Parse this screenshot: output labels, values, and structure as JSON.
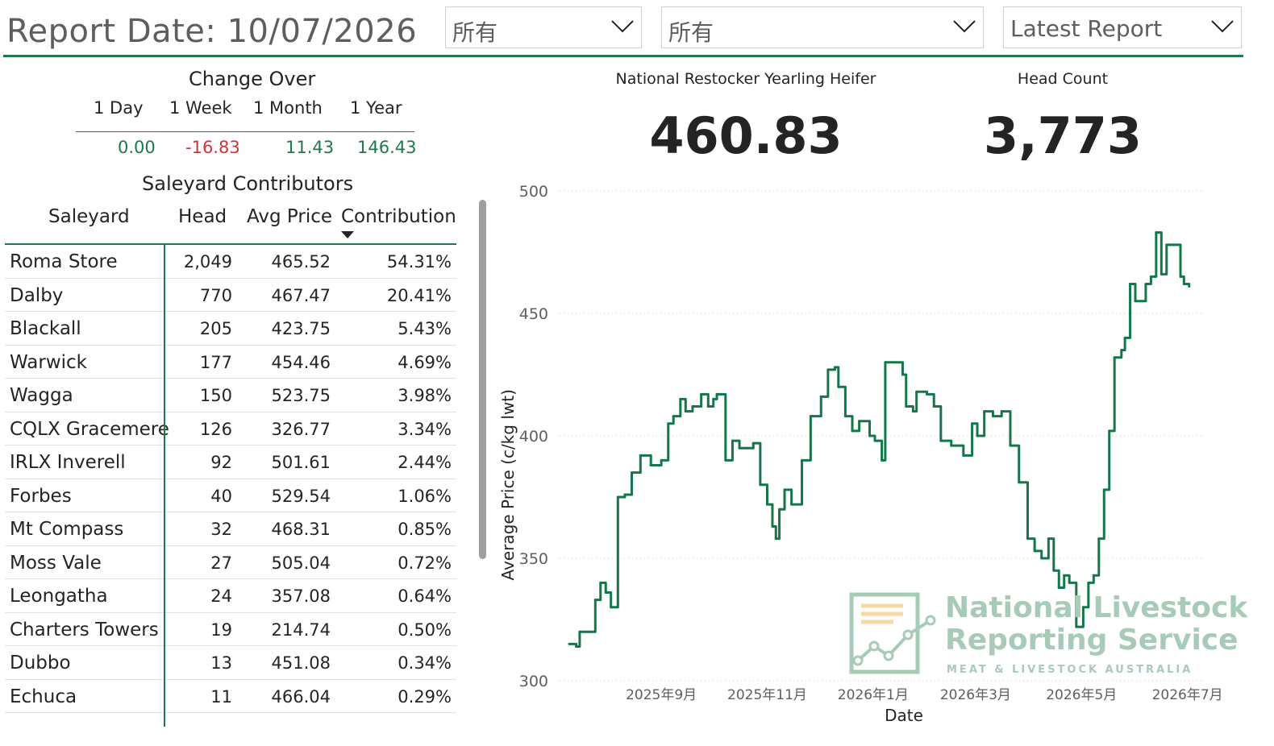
{
  "report_date": "Report Date: 10/07/2026",
  "slicers": [
    {
      "value": "所有"
    },
    {
      "value": "所有"
    },
    {
      "value": "Latest Report"
    }
  ],
  "change_over": {
    "title": "Change Over",
    "periods": [
      "1 Day",
      "1 Week",
      "1 Month",
      "1 Year"
    ],
    "values": [
      "0.00",
      "-16.83",
      "11.43",
      "146.43"
    ]
  },
  "saleyard": {
    "title": "Saleyard Contributors",
    "headers": [
      "Saleyard",
      "Head",
      "Avg Price",
      "Contribution"
    ],
    "rows": [
      {
        "name": "Roma Store",
        "head": "2,049",
        "price": "465.52",
        "contribution": "54.31%"
      },
      {
        "name": "Dalby",
        "head": "770",
        "price": "467.47",
        "contribution": "20.41%"
      },
      {
        "name": "Blackall",
        "head": "205",
        "price": "423.75",
        "contribution": "5.43%"
      },
      {
        "name": "Warwick",
        "head": "177",
        "price": "454.46",
        "contribution": "4.69%"
      },
      {
        "name": "Wagga",
        "head": "150",
        "price": "523.75",
        "contribution": "3.98%"
      },
      {
        "name": "CQLX Gracemere",
        "head": "126",
        "price": "326.77",
        "contribution": "3.34%"
      },
      {
        "name": "IRLX Inverell",
        "head": "92",
        "price": "501.61",
        "contribution": "2.44%"
      },
      {
        "name": "Forbes",
        "head": "40",
        "price": "529.54",
        "contribution": "1.06%"
      },
      {
        "name": "Mt Compass",
        "head": "32",
        "price": "468.31",
        "contribution": "0.85%"
      },
      {
        "name": "Moss Vale",
        "head": "27",
        "price": "505.04",
        "contribution": "0.72%"
      },
      {
        "name": "Leongatha",
        "head": "24",
        "price": "357.08",
        "contribution": "0.64%"
      },
      {
        "name": "Charters Towers",
        "head": "19",
        "price": "214.74",
        "contribution": "0.50%"
      },
      {
        "name": "Dubbo",
        "head": "13",
        "price": "451.08",
        "contribution": "0.34%"
      },
      {
        "name": "Echuca",
        "head": "11",
        "price": "466.04",
        "contribution": "0.29%"
      }
    ]
  },
  "kpis": [
    {
      "label": "National Restocker Yearling Heifer",
      "value": "460.83"
    },
    {
      "label": "Head Count",
      "value": "3,773"
    }
  ],
  "watermark": {
    "line1": "National Livestock",
    "line2": "Reporting Service",
    "sub": "MEAT & LIVESTOCK AUSTRALIA"
  },
  "colors": {
    "accent": "#1d7a4d",
    "negative": "#d13438",
    "line": "#13774a",
    "watermark": "#a7cbb6"
  },
  "chart_data": {
    "type": "line",
    "xlabel": "Date",
    "ylabel": "Average Price (c/kg lwt)",
    "ylim": [
      300,
      500
    ],
    "yticks": [
      300,
      350,
      400,
      450,
      500
    ],
    "xticks": [
      "2025年9月",
      "2025年11月",
      "2026年1月",
      "2026年3月",
      "2026年5月",
      "2026年7月"
    ],
    "x_range": [
      "2025-07-10",
      "2026-07-10"
    ],
    "grid": true,
    "series": [
      {
        "values": [
          [
            "2025-07-10",
            315
          ],
          [
            "2025-07-14",
            314
          ],
          [
            "2025-07-16",
            320
          ],
          [
            "2025-07-21",
            320
          ],
          [
            "2025-07-25",
            333
          ],
          [
            "2025-07-28",
            340
          ],
          [
            "2025-07-31",
            336
          ],
          [
            "2025-08-03",
            330
          ],
          [
            "2025-08-07",
            375
          ],
          [
            "2025-08-11",
            376
          ],
          [
            "2025-08-15",
            385
          ],
          [
            "2025-08-20",
            392
          ],
          [
            "2025-08-26",
            388
          ],
          [
            "2025-09-01",
            390
          ],
          [
            "2025-09-05",
            405
          ],
          [
            "2025-09-08",
            408
          ],
          [
            "2025-09-12",
            415
          ],
          [
            "2025-09-15",
            410
          ],
          [
            "2025-09-19",
            412
          ],
          [
            "2025-09-24",
            417
          ],
          [
            "2025-09-28",
            412
          ],
          [
            "2025-10-01",
            415
          ],
          [
            "2025-10-03",
            417
          ],
          [
            "2025-10-08",
            390
          ],
          [
            "2025-10-12",
            398
          ],
          [
            "2025-10-16",
            395
          ],
          [
            "2025-10-20",
            395
          ],
          [
            "2025-10-24",
            397
          ],
          [
            "2025-10-28",
            380
          ],
          [
            "2025-11-01",
            372
          ],
          [
            "2025-11-04",
            363
          ],
          [
            "2025-11-06",
            358
          ],
          [
            "2025-11-08",
            370
          ],
          [
            "2025-11-11",
            378
          ],
          [
            "2025-11-15",
            372
          ],
          [
            "2025-11-21",
            390
          ],
          [
            "2025-11-26",
            408
          ],
          [
            "2025-12-02",
            416
          ],
          [
            "2025-12-06",
            427
          ],
          [
            "2025-12-10",
            428
          ],
          [
            "2025-12-12",
            420
          ],
          [
            "2025-12-16",
            408
          ],
          [
            "2025-12-20",
            402
          ],
          [
            "2025-12-24",
            406
          ],
          [
            "2025-12-30",
            400
          ],
          [
            "2026-01-02",
            398
          ],
          [
            "2026-01-06",
            390
          ],
          [
            "2026-01-08",
            430
          ],
          [
            "2026-01-18",
            425
          ],
          [
            "2026-01-20",
            412
          ],
          [
            "2026-01-24",
            410
          ],
          [
            "2026-01-26",
            418
          ],
          [
            "2026-02-01",
            417
          ],
          [
            "2026-02-05",
            412
          ],
          [
            "2026-02-09",
            398
          ],
          [
            "2026-02-15",
            396
          ],
          [
            "2026-02-22",
            392
          ],
          [
            "2026-02-27",
            405
          ],
          [
            "2026-03-02",
            400
          ],
          [
            "2026-03-06",
            410
          ],
          [
            "2026-03-11",
            408
          ],
          [
            "2026-03-16",
            410
          ],
          [
            "2026-03-21",
            396
          ],
          [
            "2026-03-26",
            381
          ],
          [
            "2026-03-31",
            358
          ],
          [
            "2026-04-04",
            353
          ],
          [
            "2026-04-08",
            350
          ],
          [
            "2026-04-12",
            358
          ],
          [
            "2026-04-15",
            345
          ],
          [
            "2026-04-18",
            338
          ],
          [
            "2026-04-21",
            343
          ],
          [
            "2026-04-24",
            340
          ],
          [
            "2026-04-28",
            322
          ],
          [
            "2026-05-02",
            330
          ],
          [
            "2026-05-05",
            340
          ],
          [
            "2026-05-08",
            343
          ],
          [
            "2026-05-11",
            358
          ],
          [
            "2026-05-14",
            378
          ],
          [
            "2026-05-17",
            402
          ],
          [
            "2026-05-20",
            432
          ],
          [
            "2026-05-24",
            435
          ],
          [
            "2026-05-26",
            440
          ],
          [
            "2026-05-29",
            462
          ],
          [
            "2026-06-01",
            455
          ],
          [
            "2026-06-04",
            455
          ],
          [
            "2026-06-07",
            462
          ],
          [
            "2026-06-10",
            465
          ],
          [
            "2026-06-13",
            483
          ],
          [
            "2026-06-16",
            466
          ],
          [
            "2026-06-19",
            478
          ],
          [
            "2026-06-23",
            478
          ],
          [
            "2026-06-27",
            465
          ],
          [
            "2026-06-29",
            462
          ],
          [
            "2026-07-02",
            461
          ]
        ]
      }
    ]
  }
}
